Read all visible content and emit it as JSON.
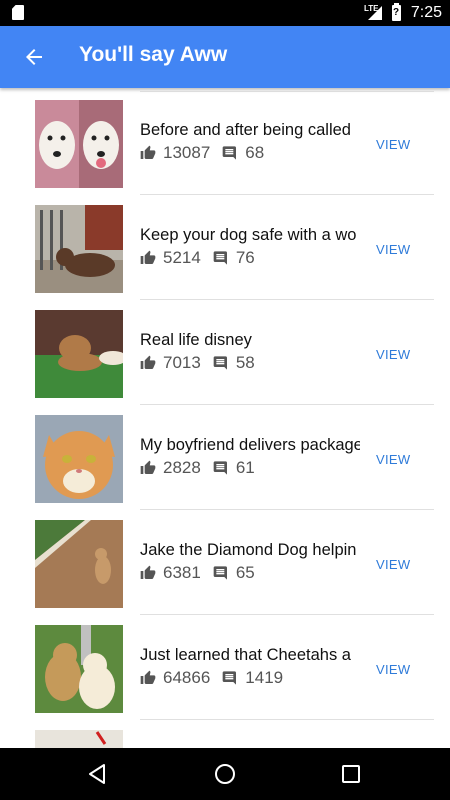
{
  "status_bar": {
    "time": "7:25",
    "network": "LTE",
    "battery_level": "?"
  },
  "app_bar": {
    "title": "You'll say Aww",
    "back_icon": "arrow-left-icon"
  },
  "list": {
    "view_label": "VIEW",
    "items": [
      {
        "title": "Before and after being called",
        "likes": "13087",
        "comments": "68"
      },
      {
        "title": "Keep your dog safe with a wo",
        "likes": "5214",
        "comments": "76"
      },
      {
        "title": "Real life disney",
        "likes": "7013",
        "comments": "58"
      },
      {
        "title": "My boyfriend delivers package",
        "likes": "2828",
        "comments": "61"
      },
      {
        "title": "Jake the Diamond Dog helpin",
        "likes": "6381",
        "comments": "65"
      },
      {
        "title": "Just learned that Cheetahs a",
        "likes": "64866",
        "comments": "1419"
      }
    ]
  },
  "colors": {
    "app_bar": "#4285f4",
    "view": "#2f7bd9"
  },
  "nav_bar": {
    "back_icon": "nav-back-icon",
    "home_icon": "nav-home-icon",
    "recents_icon": "nav-recents-icon"
  }
}
